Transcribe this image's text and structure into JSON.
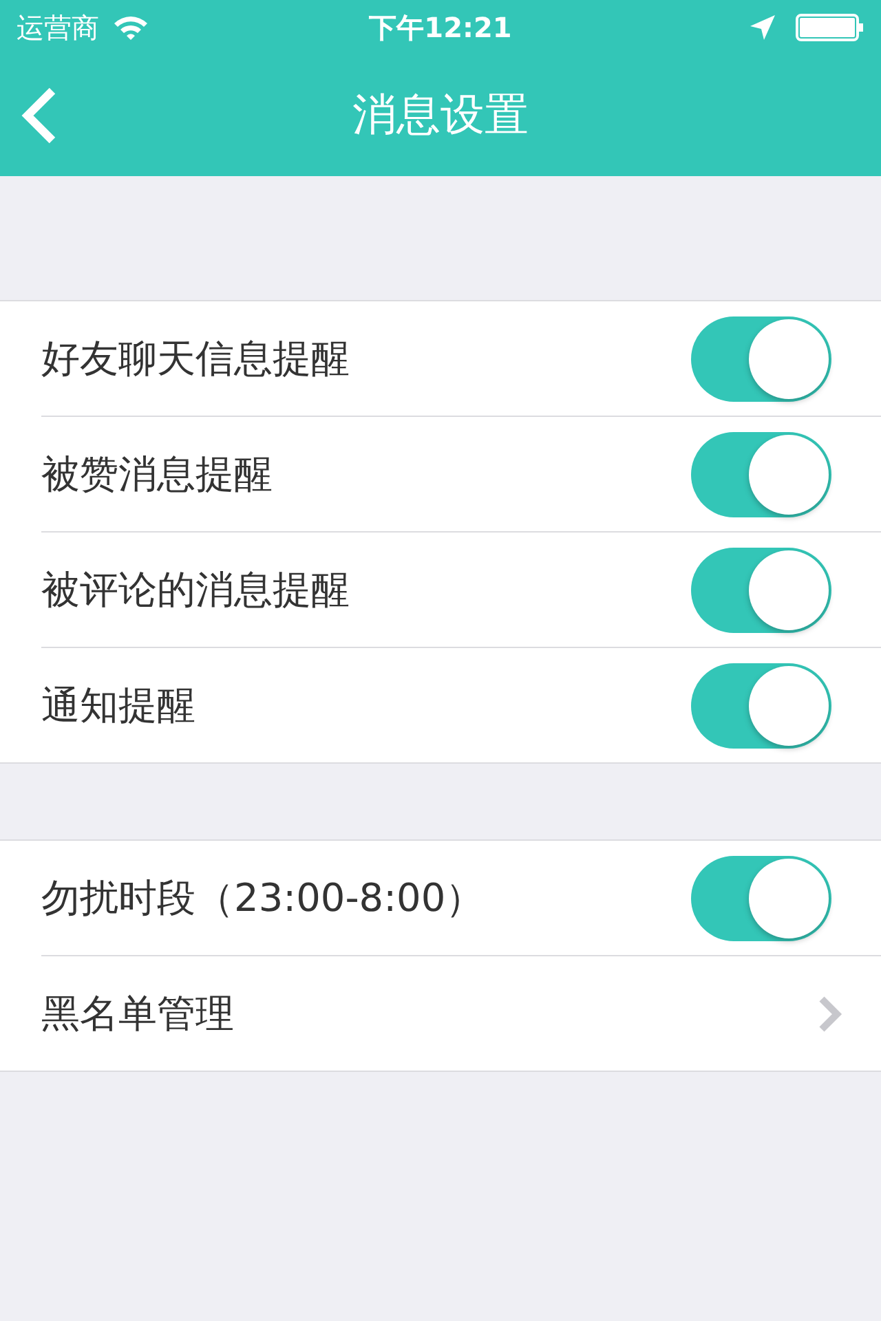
{
  "status_bar": {
    "carrier": "运营商",
    "time": "下午12:21"
  },
  "nav": {
    "title": "消息设置"
  },
  "sections": [
    {
      "items": [
        {
          "kind": "toggle",
          "label": "好友聊天信息提醒",
          "on": true
        },
        {
          "kind": "toggle",
          "label": "被赞消息提醒",
          "on": true
        },
        {
          "kind": "toggle",
          "label": "被评论的消息提醒",
          "on": true
        },
        {
          "kind": "toggle",
          "label": "通知提醒",
          "on": true
        }
      ]
    },
    {
      "items": [
        {
          "kind": "toggle",
          "label": "勿扰时段（23:00-8:00）",
          "on": true
        },
        {
          "kind": "link",
          "label": "黑名单管理"
        }
      ]
    }
  ]
}
